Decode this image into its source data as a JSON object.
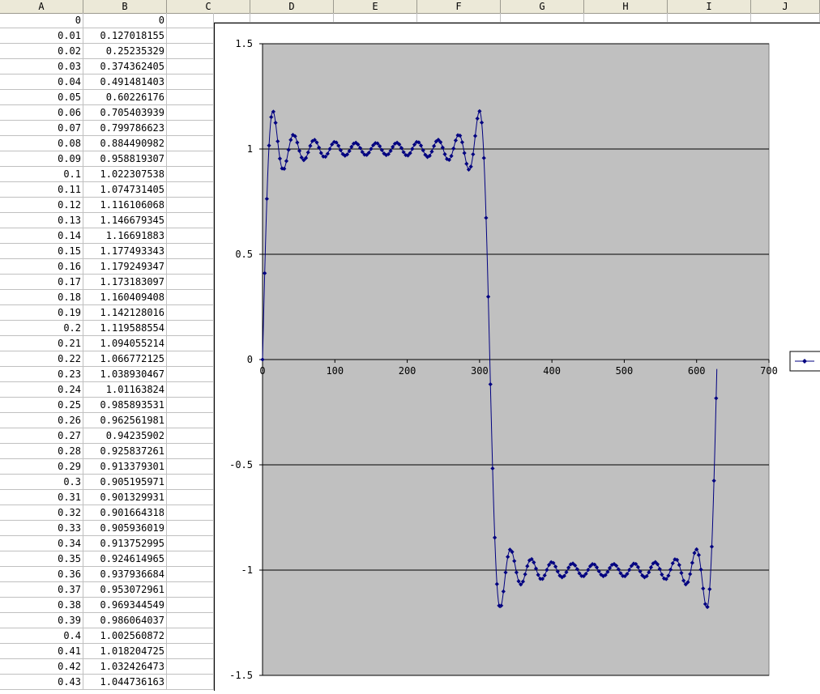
{
  "columns": [
    "A",
    "B",
    "C",
    "D",
    "E",
    "F",
    "G",
    "H",
    "I",
    "J"
  ],
  "rows": [
    [
      "0",
      "0"
    ],
    [
      "0.01",
      "0.127018155"
    ],
    [
      "0.02",
      "0.25235329"
    ],
    [
      "0.03",
      "0.374362405"
    ],
    [
      "0.04",
      "0.491481403"
    ],
    [
      "0.05",
      "0.60226176"
    ],
    [
      "0.06",
      "0.705403939"
    ],
    [
      "0.07",
      "0.799786623"
    ],
    [
      "0.08",
      "0.884490982"
    ],
    [
      "0.09",
      "0.958819307"
    ],
    [
      "0.1",
      "1.022307538"
    ],
    [
      "0.11",
      "1.074731405"
    ],
    [
      "0.12",
      "1.116106068"
    ],
    [
      "0.13",
      "1.146679345"
    ],
    [
      "0.14",
      "1.16691883"
    ],
    [
      "0.15",
      "1.177493343"
    ],
    [
      "0.16",
      "1.179249347"
    ],
    [
      "0.17",
      "1.173183097"
    ],
    [
      "0.18",
      "1.160409408"
    ],
    [
      "0.19",
      "1.142128016"
    ],
    [
      "0.2",
      "1.119588554"
    ],
    [
      "0.21",
      "1.094055214"
    ],
    [
      "0.22",
      "1.066772125"
    ],
    [
      "0.23",
      "1.038930467"
    ],
    [
      "0.24",
      "1.01163824"
    ],
    [
      "0.25",
      "0.985893531"
    ],
    [
      "0.26",
      "0.962561981"
    ],
    [
      "0.27",
      "0.94235902"
    ],
    [
      "0.28",
      "0.925837261"
    ],
    [
      "0.29",
      "0.913379301"
    ],
    [
      "0.3",
      "0.905195971"
    ],
    [
      "0.31",
      "0.901329931"
    ],
    [
      "0.32",
      "0.901664318"
    ],
    [
      "0.33",
      "0.905936019"
    ],
    [
      "0.34",
      "0.913752995"
    ],
    [
      "0.35",
      "0.924614965"
    ],
    [
      "0.36",
      "0.937936684"
    ],
    [
      "0.37",
      "0.953072961"
    ],
    [
      "0.38",
      "0.969344549"
    ],
    [
      "0.39",
      "0.986064037"
    ],
    [
      "0.4",
      "1.002560872"
    ],
    [
      "0.41",
      "1.018204725"
    ],
    [
      "0.42",
      "1.032426473"
    ],
    [
      "0.43",
      "1.044736163"
    ]
  ],
  "chart_data": {
    "type": "line",
    "xlim": [
      0,
      700
    ],
    "ylim": [
      -1.5,
      1.5
    ],
    "xticks": [
      "0",
      "100",
      "200",
      "300",
      "400",
      "500",
      "600",
      "700"
    ],
    "yticks": [
      "1.5",
      "1",
      "0.5",
      "0",
      "-0.5",
      "-1",
      "-1.5"
    ],
    "grid": "horizontal major gridlines",
    "legend": "right",
    "plot_bg": "#c0c0c0",
    "series_color": "#000080",
    "series": [
      {
        "square_wave_partial_sum": {
          "harmonics": [
            1,
            3,
            5,
            7,
            9,
            11,
            13,
            15,
            17,
            19,
            21
          ],
          "x_step": 0.01,
          "x_points": 629
        }
      }
    ]
  }
}
